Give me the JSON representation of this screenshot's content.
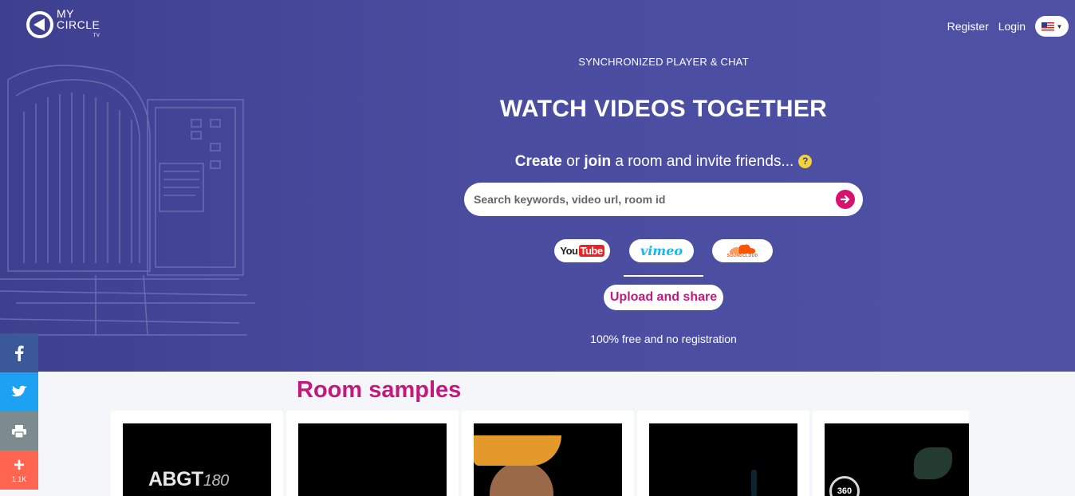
{
  "header": {
    "logo": {
      "line1": "MY",
      "line2": "CIRCLE",
      "line3": "TV"
    },
    "nav": {
      "register": "Register",
      "login": "Login"
    },
    "language": "us-flag-icon"
  },
  "hero": {
    "subtitle": "SYNCHRONIZED PLAYER & CHAT",
    "title": "WATCH VIDEOS TOGETHER",
    "tagline": {
      "create": "Create",
      "or": " or ",
      "join": "join",
      "rest": " a room and invite friends..."
    },
    "help_icon": "?",
    "search": {
      "placeholder": "Search keywords, video url, room id",
      "value": ""
    },
    "providers": [
      {
        "name": "YouTube",
        "label_you": "You",
        "label_tube": "Tube"
      },
      {
        "name": "Vimeo",
        "label": "vimeo"
      },
      {
        "name": "SoundCloud",
        "label": "SOUNDCLOUD"
      }
    ],
    "upload_label": "Upload and share",
    "free_text": "100% free and no registration"
  },
  "rooms": {
    "title": "Room samples",
    "items": [
      {
        "thumb_text": "ABGT",
        "thumb_num": "180"
      },
      {
        "thumb_text": ""
      },
      {
        "thumb_text": ""
      },
      {
        "thumb_text": ""
      },
      {
        "thumb_text": "360"
      }
    ]
  },
  "social": {
    "share_count": "1.1K"
  },
  "colors": {
    "hero_bg": "#4a4c9f",
    "accent": "#c3187d",
    "search_go": "#d8106e",
    "facebook": "#3b5998",
    "twitter": "#1da1f2",
    "print": "#7b8b8e",
    "more": "#ff6550"
  }
}
